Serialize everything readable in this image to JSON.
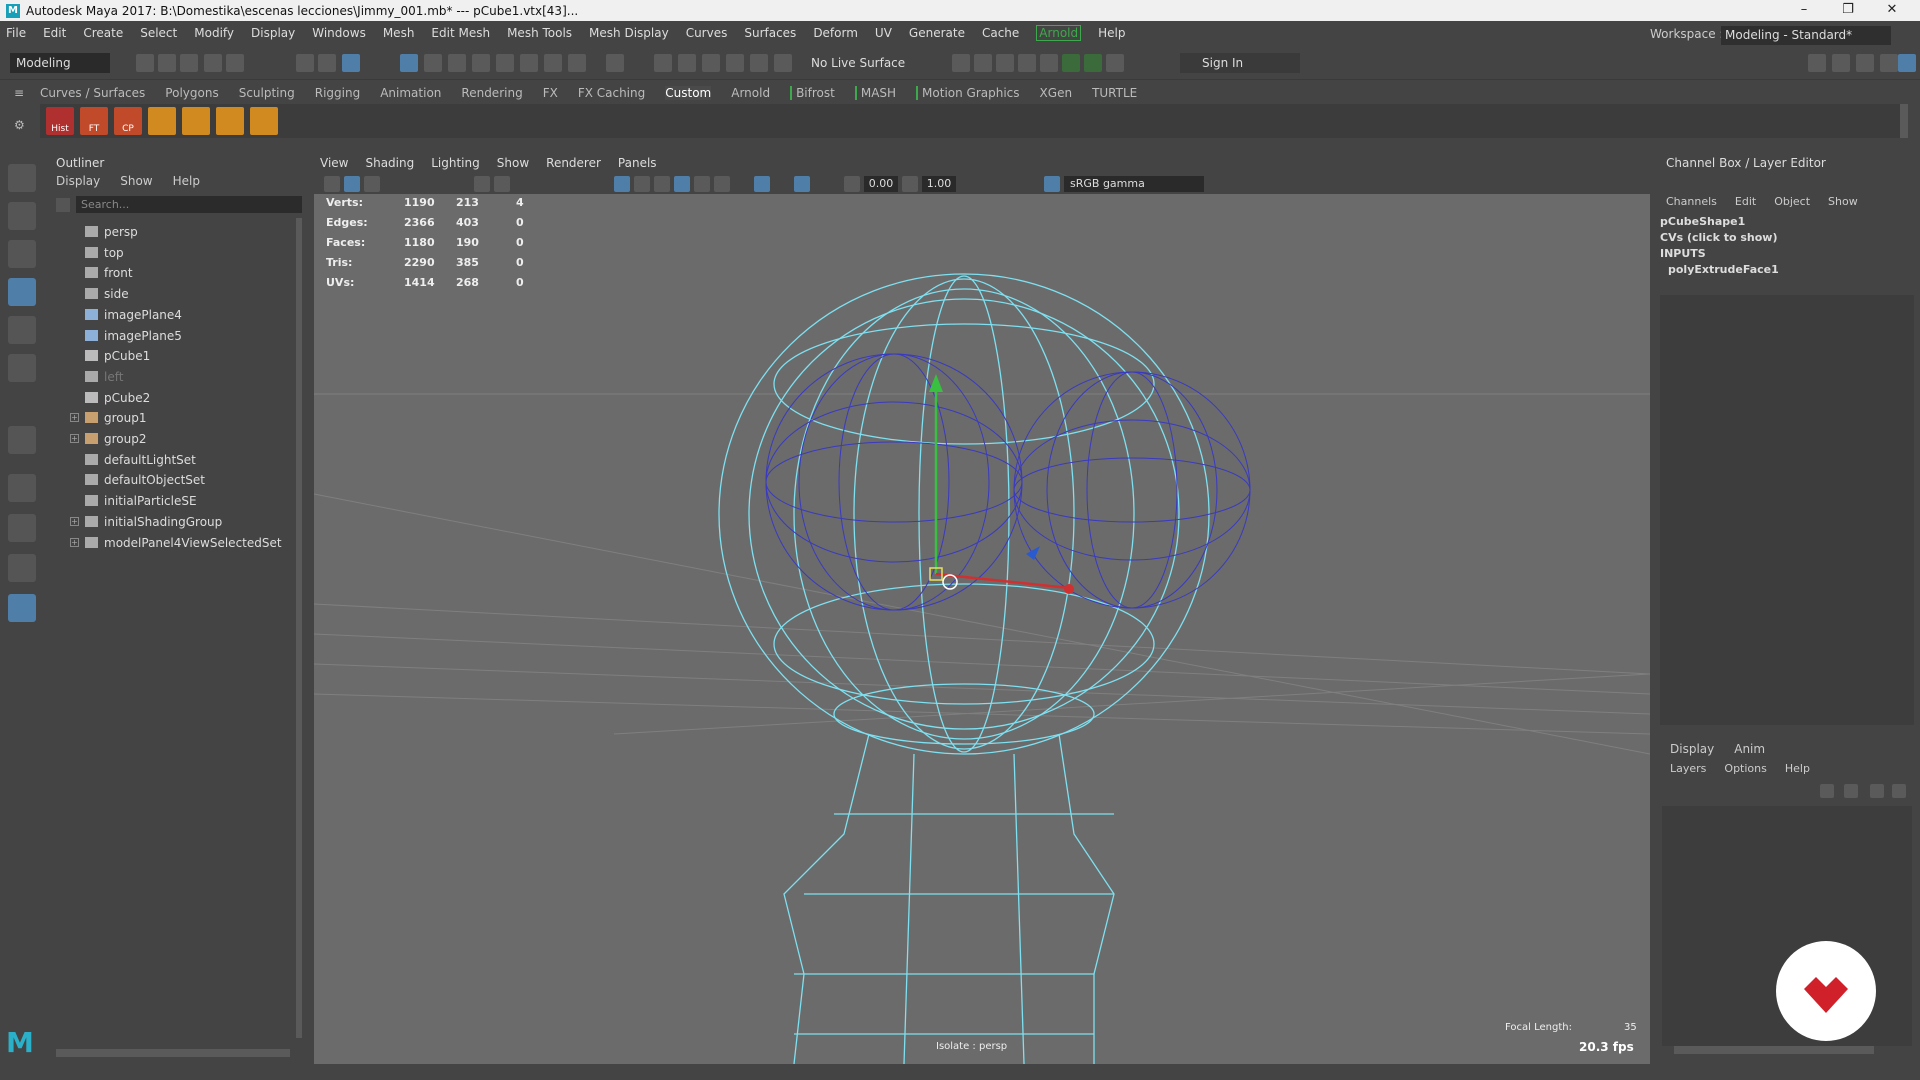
{
  "window": {
    "title": "Autodesk Maya 2017: B:\\Domestika\\escenas lecciones\\Jimmy_001.mb*   ---   pCube1.vtx[43]...",
    "controls": [
      "–",
      "❐",
      "✕"
    ]
  },
  "menubar": [
    "File",
    "Edit",
    "Create",
    "Select",
    "Modify",
    "Display",
    "Windows",
    "Mesh",
    "Edit Mesh",
    "Mesh Tools",
    "Mesh Display",
    "Curves",
    "Surfaces",
    "Deform",
    "UV",
    "Generate",
    "Cache",
    "Arnold",
    "Help"
  ],
  "workspace": {
    "label": "Workspace :",
    "value": "Modeling - Standard*"
  },
  "statusline": {
    "mode": "Modeling",
    "live_surface": "No Live Surface",
    "sign_in": "Sign In"
  },
  "shelf_tabs": [
    "Curves / Surfaces",
    "Polygons",
    "Sculpting",
    "Rigging",
    "Animation",
    "Rendering",
    "FX",
    "FX Caching",
    "Custom",
    "Arnold",
    "Bifrost",
    "MASH",
    "Motion Graphics",
    "XGen",
    "TURTLE"
  ],
  "shelf_current": "Custom",
  "shelf_icons": [
    {
      "label": "Hist",
      "color": "#b03030"
    },
    {
      "label": "FT",
      "color": "#c04a2a"
    },
    {
      "label": "CP",
      "color": "#c04a2a"
    },
    {
      "label": "",
      "color": "#d08a20"
    },
    {
      "label": "",
      "color": "#d08a20"
    },
    {
      "label": "",
      "color": "#d08a20"
    },
    {
      "label": "",
      "color": "#d08a20"
    }
  ],
  "outliner": {
    "title": "Outliner",
    "menu": [
      "Display",
      "Show",
      "Help"
    ],
    "search_placeholder": "Search...",
    "items": [
      {
        "label": "persp",
        "icon": "camera-icon",
        "expand": false
      },
      {
        "label": "top",
        "icon": "camera-icon",
        "expand": false
      },
      {
        "label": "front",
        "icon": "camera-icon",
        "expand": false
      },
      {
        "label": "side",
        "icon": "camera-icon",
        "expand": false
      },
      {
        "label": "imagePlane4",
        "icon": "image-plane-icon",
        "expand": false
      },
      {
        "label": "imagePlane5",
        "icon": "image-plane-icon",
        "expand": false
      },
      {
        "label": "pCube1",
        "icon": "mesh-icon",
        "expand": false
      },
      {
        "label": "left",
        "icon": "camera-icon",
        "expand": false,
        "dim": true
      },
      {
        "label": "pCube2",
        "icon": "mesh-icon",
        "expand": false
      },
      {
        "label": "group1",
        "icon": "group-icon",
        "expand": true
      },
      {
        "label": "group2",
        "icon": "group-icon",
        "expand": true
      },
      {
        "label": "defaultLightSet",
        "icon": "set-icon",
        "expand": false
      },
      {
        "label": "defaultObjectSet",
        "icon": "set-icon",
        "expand": false
      },
      {
        "label": "initialParticleSE",
        "icon": "set-icon",
        "expand": false
      },
      {
        "label": "initialShadingGroup",
        "icon": "set-icon",
        "expand": true
      },
      {
        "label": "modelPanel4ViewSelectedSet",
        "icon": "set-icon",
        "expand": true
      }
    ]
  },
  "viewport": {
    "menu": [
      "View",
      "Shading",
      "Lighting",
      "Show",
      "Renderer",
      "Panels"
    ],
    "exposure": "0.00",
    "gamma": "1.00",
    "color_space": "sRGB gamma",
    "hud": [
      {
        "label": "Verts:",
        "a": "1190",
        "b": "213",
        "c": "4"
      },
      {
        "label": "Edges:",
        "a": "2366",
        "b": "403",
        "c": "0"
      },
      {
        "label": "Faces:",
        "a": "1180",
        "b": "190",
        "c": "0"
      },
      {
        "label": "Tris:",
        "a": "2290",
        "b": "385",
        "c": "0"
      },
      {
        "label": "UVs:",
        "a": "1414",
        "b": "268",
        "c": "0"
      }
    ],
    "focal_label": "Focal Length:",
    "focal_value": "35",
    "fps": "20.3 fps",
    "isolate": "Isolate : persp"
  },
  "channel_box": {
    "title": "Channel Box / Layer Editor",
    "menu": [
      "Channels",
      "Edit",
      "Object",
      "Show"
    ],
    "object": "pCubeShape1",
    "cvs": "CVs (click to show)",
    "inputs": "INPUTS",
    "node": "polyExtrudeFace1"
  },
  "layer_editor": {
    "tabs": [
      "Display",
      "Anim"
    ],
    "menu": [
      "Layers",
      "Options",
      "Help"
    ]
  }
}
